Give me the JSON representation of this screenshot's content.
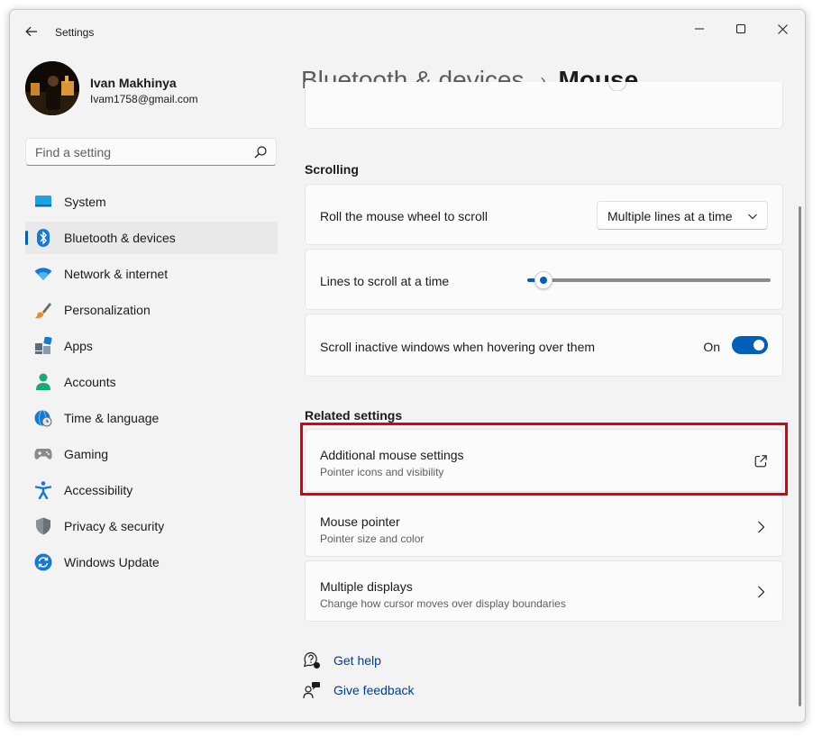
{
  "window": {
    "title": "Settings"
  },
  "profile": {
    "name": "Ivan Makhinya",
    "email": "Ivam1758@gmail.com"
  },
  "search": {
    "placeholder": "Find a setting",
    "value": ""
  },
  "sidebar": {
    "items": [
      {
        "label": "System",
        "icon": "system-icon",
        "active": false
      },
      {
        "label": "Bluetooth & devices",
        "icon": "bluetooth-icon",
        "active": true
      },
      {
        "label": "Network & internet",
        "icon": "wifi-icon",
        "active": false
      },
      {
        "label": "Personalization",
        "icon": "brush-icon",
        "active": false
      },
      {
        "label": "Apps",
        "icon": "apps-icon",
        "active": false
      },
      {
        "label": "Accounts",
        "icon": "person-icon",
        "active": false
      },
      {
        "label": "Time & language",
        "icon": "globe-clock-icon",
        "active": false
      },
      {
        "label": "Gaming",
        "icon": "gamepad-icon",
        "active": false
      },
      {
        "label": "Accessibility",
        "icon": "accessibility-icon",
        "active": false
      },
      {
        "label": "Privacy & security",
        "icon": "shield-icon",
        "active": false
      },
      {
        "label": "Windows Update",
        "icon": "sync-icon",
        "active": false
      }
    ]
  },
  "header": {
    "parent": "Bluetooth & devices",
    "separator": "›",
    "current": "Mouse"
  },
  "scrolling": {
    "title": "Scrolling",
    "roll_label": "Roll the mouse wheel to scroll",
    "roll_value": "Multiple lines at a time",
    "lines_label": "Lines to scroll at a time",
    "lines_level": 0.03,
    "inactive_label": "Scroll inactive windows when hovering over them",
    "inactive_state": "On"
  },
  "related": {
    "title": "Related settings",
    "items": [
      {
        "label": "Additional mouse settings",
        "sub": "Pointer icons and visibility",
        "icon": "open-external-icon",
        "highlighted": true
      },
      {
        "label": "Mouse pointer",
        "sub": "Pointer size and color",
        "icon": "chevron-right-icon",
        "highlighted": false
      },
      {
        "label": "Multiple displays",
        "sub": "Change how cursor moves over display boundaries",
        "icon": "chevron-right-icon",
        "highlighted": false
      }
    ]
  },
  "help": {
    "get_help": "Get help",
    "give_feedback": "Give feedback"
  },
  "colors": {
    "accent": "#005fb8",
    "highlight": "#e0000b",
    "link": "#003e92"
  }
}
